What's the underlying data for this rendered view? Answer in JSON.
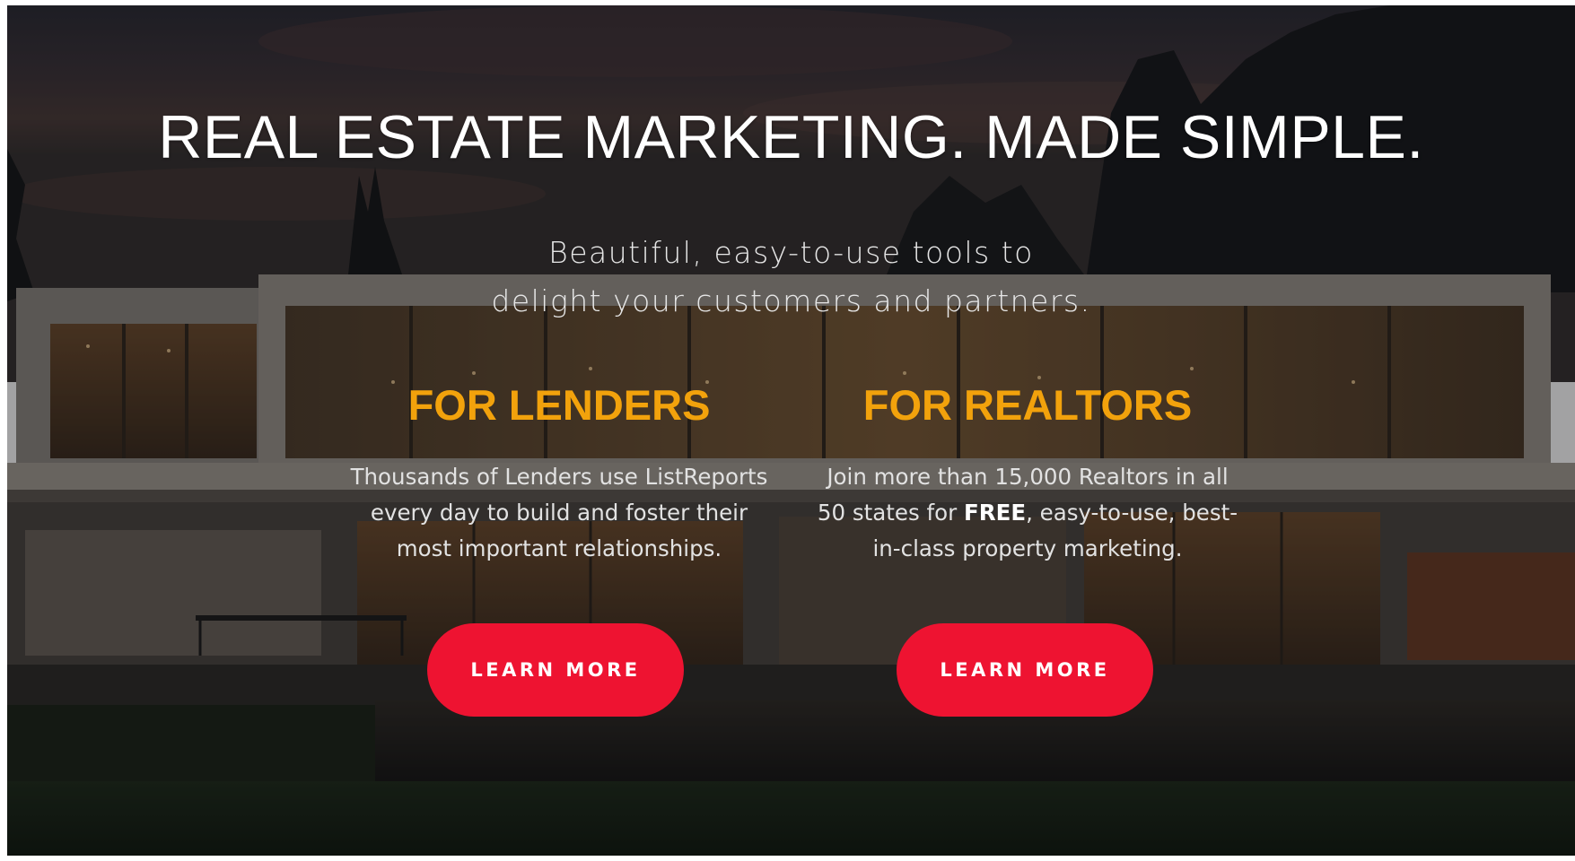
{
  "hero": {
    "headline": "REAL ESTATE MARKETING. MADE SIMPLE.",
    "subline_1": "Beautiful, easy-to-use tools to",
    "subline_2": "delight your customers and partners."
  },
  "lenders": {
    "title": "FOR LENDERS",
    "text_lines": [
      "Thousands of Lenders use ListReports",
      "every day to build and foster their",
      "most important relationships."
    ],
    "button_label": "LEARN MORE"
  },
  "realtors": {
    "title": "FOR REALTORS",
    "text_line_1": "Join more than 15,000 Realtors in all",
    "text_line_2_before": "50 states for ",
    "text_line_2_bold": "FREE",
    "text_line_2_after": ", easy-to-use, best-",
    "text_line_3": "in-class property marketing.",
    "button_label": "LEARN MORE"
  },
  "colors": {
    "accent_orange": "#f2a20c",
    "button_red": "#ee1331",
    "text_white": "#ffffff"
  },
  "background": {
    "image": "modern-house-at-dusk-photo"
  }
}
